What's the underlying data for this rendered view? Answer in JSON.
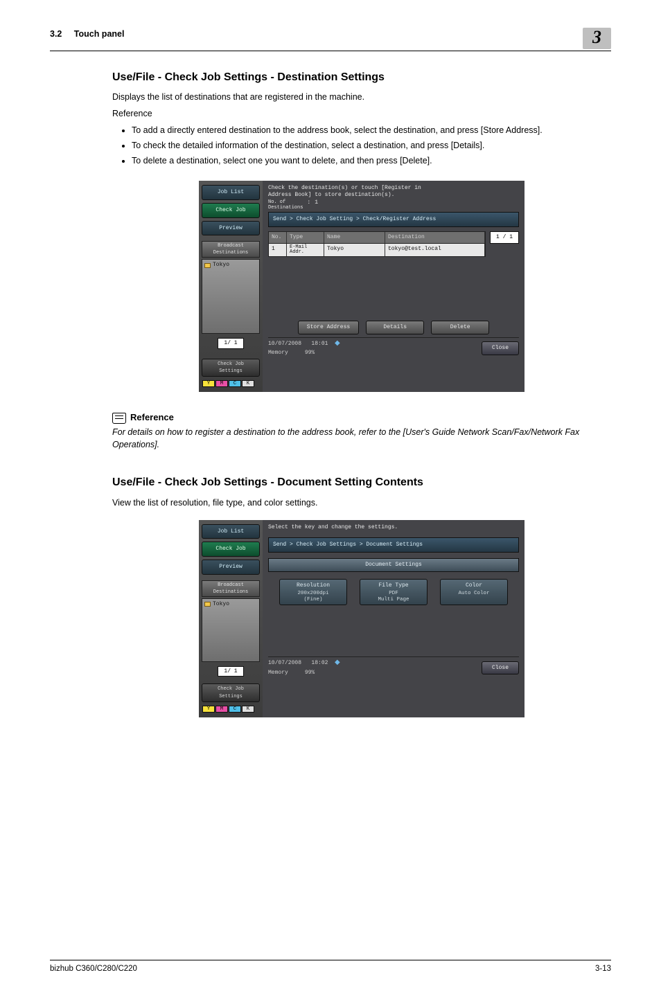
{
  "page": {
    "section_number": "3.2",
    "section_label": "Touch panel",
    "chapter_badge": "3",
    "footer_left": "bizhub C360/C280/C220",
    "footer_right": "3-13"
  },
  "sec1": {
    "title": "Use/File - Check Job Settings - Destination Settings",
    "lead": "Displays the list of destinations that are registered in the machine.",
    "reference_label": "Reference",
    "bullets": [
      "To add a directly entered destination to the address book, select the destination, and press [Store Address].",
      "To check the detailed information of the destination, select a destination, and press [Details].",
      "To delete a destination, select one you want to delete, and then press [Delete]."
    ]
  },
  "screenshot1": {
    "left": {
      "job_list": "Job List",
      "check_job": "Check Job",
      "preview": "Preview",
      "broadcast": "Broadcast\nDestinations",
      "item1": "Tokyo",
      "page": "1/  1",
      "settings": "Check Job\nSettings"
    },
    "instr_line1": "Check the destination(s) or touch [Register in",
    "instr_line2": "Address Book] to store destination(s).",
    "no_of_dest_label": "No. of\nDestinations",
    "no_of_dest_sep": ":",
    "no_of_dest_val": "1",
    "breadcrumb": "Send > Check Job Setting > Check/Register Address",
    "cols": {
      "no": "No.",
      "type": "Type",
      "name": "Name",
      "dest": "Destination"
    },
    "row1": {
      "no": "1",
      "type": "E-Mail\nAddr.",
      "name": "Tokyo",
      "dest": "tokyo@test.local"
    },
    "page_badge": "1 / 1",
    "actions": {
      "store": "Store Address",
      "details": "Details",
      "delete": "Delete"
    },
    "status": {
      "date": "10/07/2008",
      "time": "18:01",
      "memory_label": "Memory",
      "memory_val": "99%",
      "close": "Close"
    },
    "toner": {
      "y": "Y",
      "m": "M",
      "c": "C",
      "k": "K"
    }
  },
  "reference": {
    "heading": "Reference",
    "text": "For details on how to register a destination to the address book, refer to the [User's Guide Network Scan/Fax/Network Fax Operations]."
  },
  "sec2": {
    "title": "Use/File - Check Job Settings - Document Setting Contents",
    "lead": "View the list of resolution, file type, and color settings."
  },
  "screenshot2": {
    "instr": "Select the key and change the settings.",
    "breadcrumb": "Send > Check Job Settings > Document Settings",
    "doc_header": "Document Settings",
    "tiles": {
      "resolution": {
        "label": "Resolution",
        "val": "200x200dpi\n(Fine)"
      },
      "filetype": {
        "label": "File Type",
        "val": "PDF\nMulti Page"
      },
      "color": {
        "label": "Color",
        "val": "Auto Color"
      }
    },
    "status": {
      "date": "10/07/2008",
      "time": "18:02",
      "memory_label": "Memory",
      "memory_val": "99%",
      "close": "Close"
    }
  }
}
